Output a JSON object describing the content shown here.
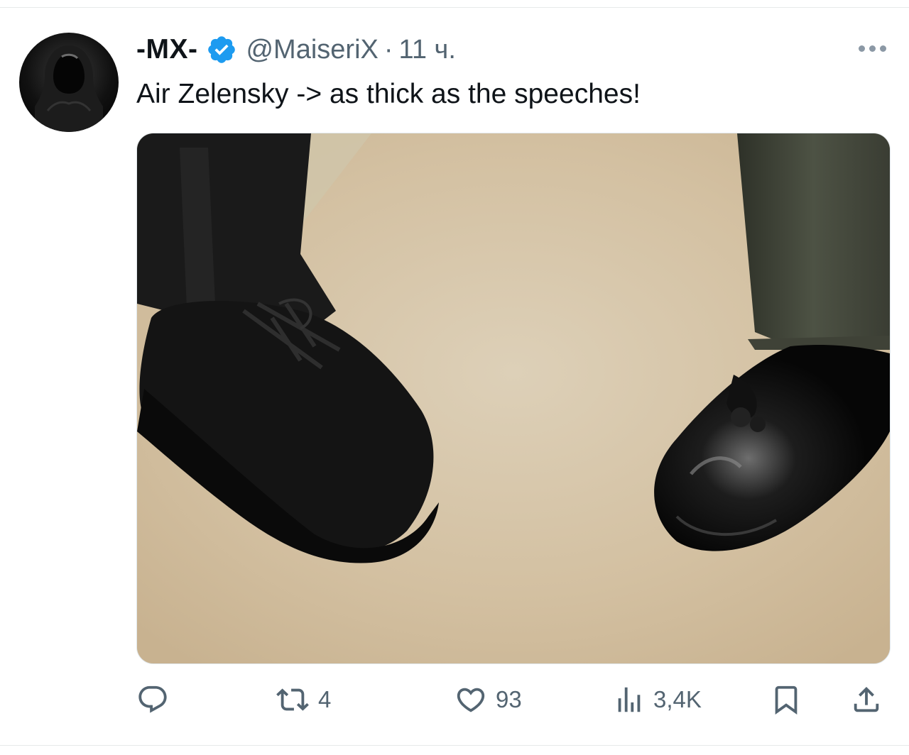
{
  "tweet": {
    "author_name": "-MX-",
    "handle": "@MaiseriX",
    "separator": "·",
    "time": "11 ч.",
    "text": "Air Zelensky -> as thick as the speeches!"
  },
  "actions": {
    "reply_count": "",
    "retweet_count": "4",
    "like_count": "93",
    "views_count": "3,4K"
  },
  "icons": {
    "verified": "verified-badge-icon",
    "more": "more-dots-icon",
    "reply": "reply-icon",
    "retweet": "retweet-icon",
    "like": "heart-icon",
    "views": "views-icon",
    "bookmark": "bookmark-icon",
    "share": "share-icon"
  },
  "colors": {
    "verified": "#1d9bf0",
    "secondary_text": "#536471",
    "primary_text": "#0f1419"
  }
}
